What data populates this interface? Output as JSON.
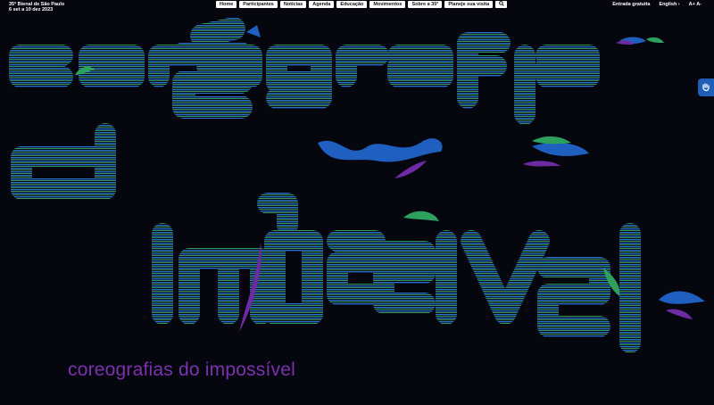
{
  "brand": {
    "line1": "35ª Bienal de São Paulo",
    "line2": "6 set a 10 dez 2023"
  },
  "nav": {
    "items": [
      "Home",
      "Participantes",
      "Notícias",
      "Agenda",
      "Educação",
      "Movimentos",
      "Sobre a 35ª",
      "Planeje sua visita"
    ],
    "search_icon": "search-icon"
  },
  "right": {
    "free_entry": "Entrada gratuita",
    "language": "English ›",
    "font_increase": "A+",
    "font_decrease": "A-"
  },
  "accessibility": {
    "icon": "hand-accessibility-icon",
    "color": "#1f5fb8"
  },
  "artwork": {
    "lines": [
      "coreográfias",
      "do",
      "impossível"
    ],
    "line_color_a": "#2f6fd6",
    "line_color_b": "#2f9b5a"
  },
  "subtitle": "coreografias do impossível",
  "colors": {
    "background": "#06060e",
    "subtitle": "#7b32b0",
    "blue_shape": "#1e5fc0",
    "purple_shape": "#6c2aa3",
    "green_shape": "#2ea05e"
  }
}
